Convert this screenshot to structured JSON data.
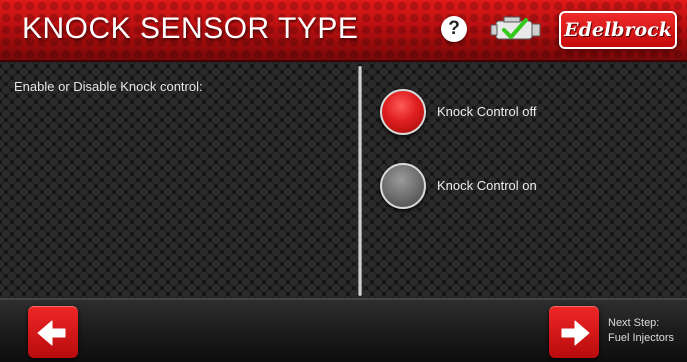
{
  "header": {
    "title": "KNOCK SENSOR TYPE",
    "help_icon_glyph": "?",
    "brand": "Edelbrock",
    "accent_color": "#c8100f",
    "icons": [
      "help-icon",
      "engine-check-icon"
    ]
  },
  "main": {
    "prompt": "Enable or Disable Knock control:",
    "options": [
      {
        "label": "Knock Control off",
        "selected": true,
        "color": "#e01e1e"
      },
      {
        "label": "Knock Control on",
        "selected": false,
        "color": "#6a6a6a"
      }
    ]
  },
  "footer": {
    "back_icon": "arrow-left-icon",
    "next_icon": "arrow-right-icon",
    "next_step_label": "Next Step:",
    "next_step_value": "Fuel Injectors"
  }
}
